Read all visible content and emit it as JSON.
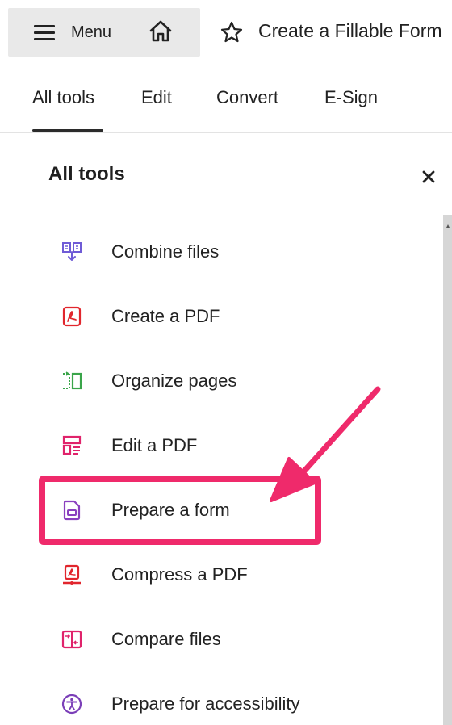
{
  "header": {
    "menu_label": "Menu",
    "document_title": "Create a Fillable Form"
  },
  "tabs": [
    {
      "label": "All tools",
      "active": true
    },
    {
      "label": "Edit",
      "active": false
    },
    {
      "label": "Convert",
      "active": false
    },
    {
      "label": "E-Sign",
      "active": false
    }
  ],
  "panel": {
    "title": "All tools"
  },
  "tools": [
    {
      "label": "Combine files",
      "icon": "combine-files-icon",
      "color": "#6f5bd6"
    },
    {
      "label": "Create a PDF",
      "icon": "create-pdf-icon",
      "color": "#e1262d"
    },
    {
      "label": "Organize pages",
      "icon": "organize-pages-icon",
      "color": "#3aa54a"
    },
    {
      "label": "Edit a PDF",
      "icon": "edit-pdf-icon",
      "color": "#e0236b"
    },
    {
      "label": "Prepare a form",
      "icon": "prepare-form-icon",
      "color": "#8a3fbf"
    },
    {
      "label": "Compress a PDF",
      "icon": "compress-pdf-icon",
      "color": "#e1262d"
    },
    {
      "label": "Compare files",
      "icon": "compare-files-icon",
      "color": "#e0236b"
    },
    {
      "label": "Prepare for accessibility",
      "icon": "accessibility-icon",
      "color": "#7b3fb8"
    }
  ],
  "annotation": {
    "highlighted_tool": "Prepare a form",
    "color": "#ef2a6b"
  }
}
